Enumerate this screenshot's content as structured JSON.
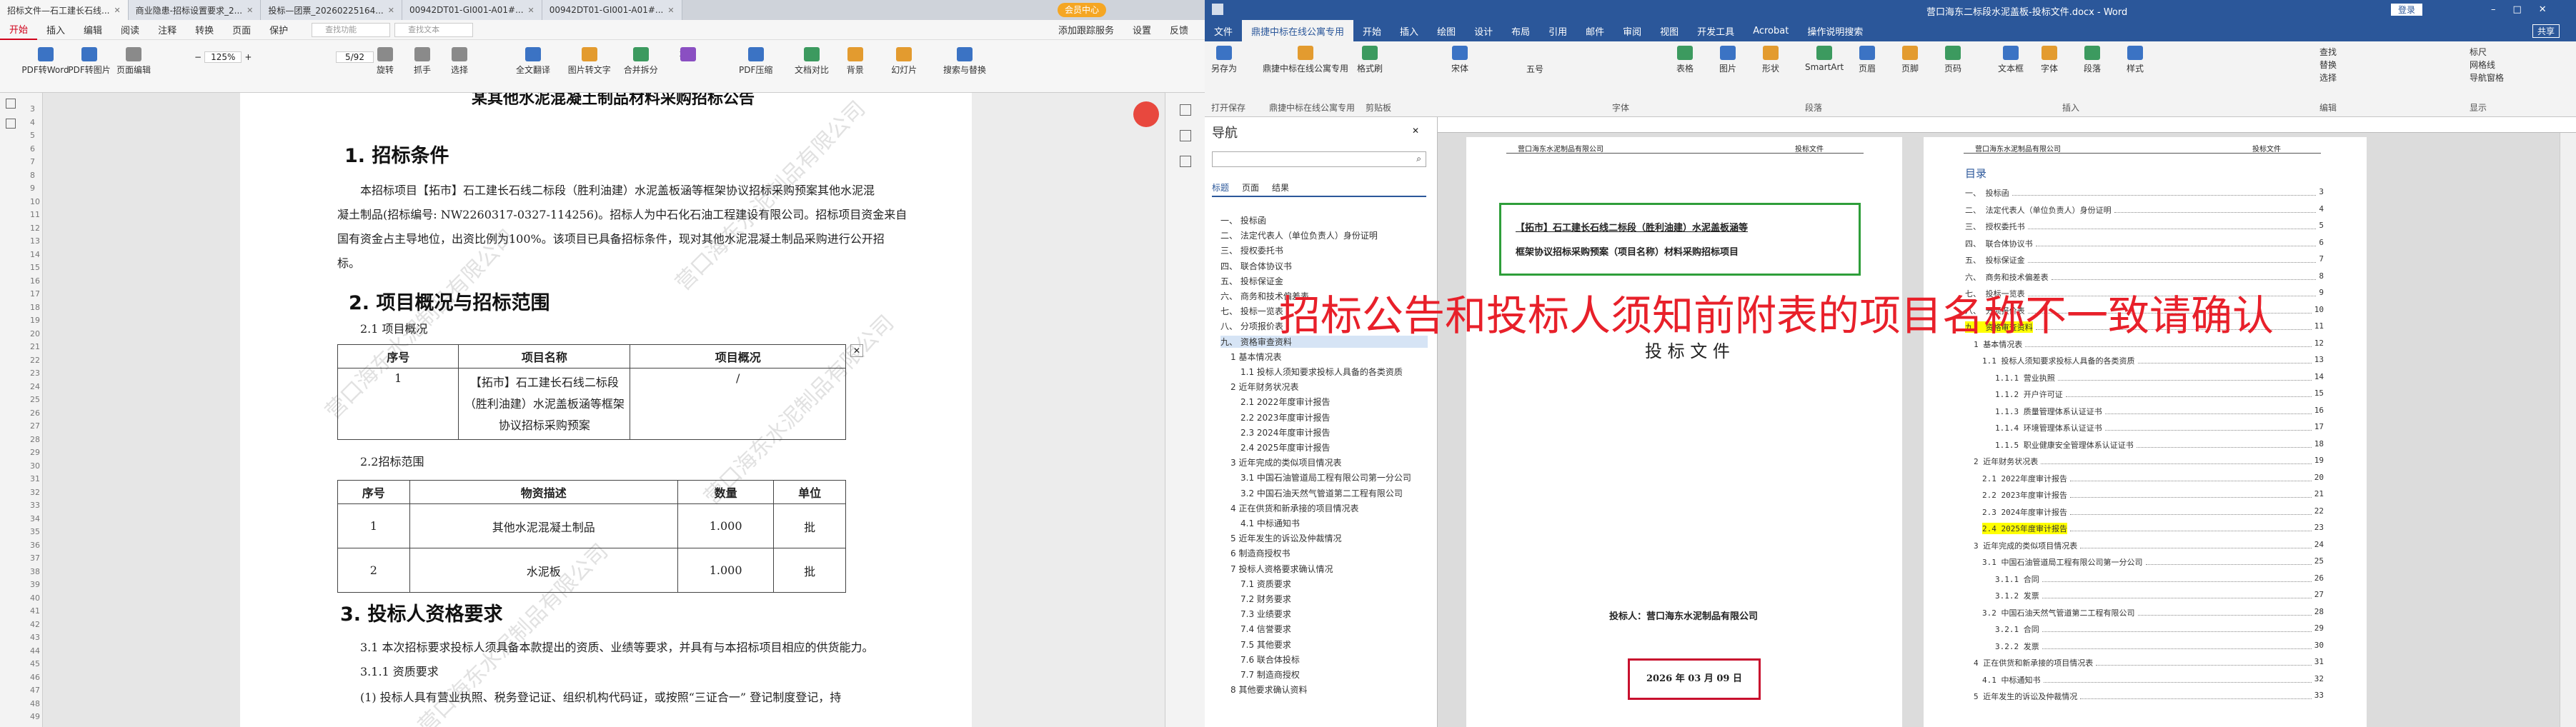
{
  "left": {
    "tabs": [
      "招标文件—石工建长石线...",
      "商业隐患-招标设置要求_2...",
      "投标—团票_20260225164...",
      "00942DT01-GI001-A01#...",
      "00942DT01-GI001-A01#..."
    ],
    "account": "会员中心",
    "menus": [
      "开始",
      "插入",
      "编辑",
      "阅读",
      "注释",
      "转换",
      "页面",
      "保护"
    ],
    "menus_right": [
      "添加跟踪服务",
      "设置",
      "反馈"
    ],
    "search_tool": "查找功能",
    "search_text": "查找文本",
    "toolbar": [
      "PDF转Word",
      "PDF转图片",
      "页面编辑",
      "旋转",
      "抓手",
      "选择",
      "全文翻译",
      "图片转文字",
      "合并拆分",
      "水印",
      "PDF压缩",
      "文档对比",
      "背景",
      "幻灯片",
      "搜索与替换"
    ],
    "zoom": "125%",
    "page": "5/92",
    "sidebar_nums": [
      "3",
      "4",
      "5",
      "6",
      "7",
      "8",
      "9",
      "10",
      "11",
      "12",
      "13",
      "14",
      "15",
      "16",
      "17",
      "18",
      "19",
      "20",
      "21",
      "22",
      "23",
      "24",
      "25",
      "26",
      "27",
      "28",
      "29",
      "30",
      "31",
      "32",
      "33",
      "34",
      "35",
      "36",
      "37",
      "38",
      "39",
      "40",
      "41",
      "42",
      "43",
      "44",
      "45",
      "46",
      "47",
      "48",
      "49"
    ],
    "doc": {
      "top_title": "某其他水泥混凝土制品材料采购招标公告",
      "h1": "1. 招标条件",
      "para1": [
        "本招标项目【拓市】石工建长石线二标段（胜利油建）水泥盖板涵等框架协议招标采购预案其他水泥混",
        "凝土制品(招标编号: NW2260317-0327-114256)。招标人为中石化石油工程建设有限公司。招标项目资金来自",
        "国有资金占主导地位，出资比例为100%。该项目已具备招标条件，现对其他水泥混凝土制品采购进行公开招",
        "标。"
      ],
      "h2": "2. 项目概况与招标范围",
      "sub21": "2.1 项目概况",
      "t1_head": [
        "序号",
        "项目名称",
        "项目概况"
      ],
      "t1_row": [
        "1",
        "【拓市】石工建长石线二标段（胜利油建）水泥盖板涵等框架协议招标采购预案",
        "/"
      ],
      "sub22": "2.2招标范围",
      "t2_head": [
        "序号",
        "物资描述",
        "数量",
        "单位"
      ],
      "t2_rows": [
        [
          "1",
          "其他水泥混凝土制品",
          "1.000",
          "批"
        ],
        [
          "2",
          "水泥板",
          "1.000",
          "批"
        ]
      ],
      "h3": "3. 投标人资格要求",
      "para3": "3.1 本次招标要求投标人须具备本款提出的资质、业绩等要求，并具有与本招标项目相应的供货能力。",
      "sub311": "3.1.1 资质要求",
      "para4": "(1)     投标人具有营业执照、税务登记证、组织机构代码证，或按照“三证合一” 登记制度登记，持",
      "watermark": "营口海东水泥制品有限公司"
    }
  },
  "right": {
    "title": "营口海东二标段水泥盖板-投标文件.docx - Word",
    "user": "登录",
    "share": "共享",
    "tabs": [
      "文件",
      "鼎捷中标在线公寓专用",
      "开始",
      "插入",
      "绘图",
      "设计",
      "布局",
      "引用",
      "邮件",
      "审阅",
      "视图",
      "开发工具",
      "Acrobat",
      "操作说明搜索"
    ],
    "ribbon": [
      "另存为",
      "鼎捷中标在线公寓专用",
      "格式刷",
      "宋体",
      "五号",
      "表格",
      "图片",
      "形状",
      "SmartArt",
      "页眉",
      "页脚",
      "页码",
      "文本框",
      "字体",
      "段落",
      "样式",
      "查找",
      "替换",
      "选择",
      "标尺",
      "网格线",
      "导航窗格"
    ],
    "ribbon_labels": [
      "打开保存",
      "鼎捷中标在线公寓专用",
      "剪贴板",
      "字体",
      "段落",
      "插入",
      "编辑",
      "显示"
    ],
    "nav_title": "导航",
    "nav_tabs": [
      "标题",
      "页面",
      "结果"
    ],
    "nav_items": [
      "一、 投标函",
      "二、 法定代表人（单位负责人）身份证明",
      "三、 授权委托书",
      "四、 联合体协议书",
      "五、 投标保证金",
      "六、 商务和技术偏差表",
      "七、 投标一览表",
      "八、 分项报价表",
      "九、 资格审查资料",
      "1 基本情况表",
      "1.1 投标人须知要求投标人具备的各类资质",
      "2 近年财务状况表",
      "2.1 2022年度审计报告",
      "2.2 2023年度审计报告",
      "2.3 2024年度审计报告",
      "2.4 2025年度审计报告",
      "3 近年完成的类似项目情况表",
      "3.1 中国石油管道局工程有限公司第一分公司",
      "3.2 中国石油天然气管道第二工程有限公司",
      "4 正在供货和新承接的项目情况表",
      "4.1 中标通知书",
      "5 近年发生的诉讼及仲裁情况",
      "6 制造商授权书",
      "7 投标人资格要求确认情况",
      "7.1 资质要求",
      "7.2 财务要求",
      "7.3 业绩要求",
      "7.4 信誉要求",
      "7.5 其他要求",
      "7.6 联合体投标",
      "7.7 制造商授权",
      "8 其他要求确认资料"
    ],
    "cover": {
      "header_left": "营口海东水泥制品有限公司",
      "header_right": "投标文件",
      "box_text": [
        "【拓市】石工建长石线二标段（胜利油建）水泥盖板涵等",
        "框架协议招标采购预案（项目名称）材料采购招标项目"
      ],
      "doc_type": "投 标 文 件",
      "bidder": "投标人：营口海东水泥制品有限公司",
      "date": "2026 年 03 月 09 日"
    },
    "toc": {
      "header_left": "营口海东水泥制品有限公司",
      "header_right": "投标文件",
      "title": "目录",
      "items": [
        "一、 投标函",
        "二、 法定代表人（单位负责人）身份证明",
        "三、 授权委托书",
        "四、 联合体协议书",
        "五、 投标保证金",
        "六、 商务和技术偏差表",
        "七、 投标一览表",
        "八、 分项报价表",
        "九、 资格审查资料",
        "1 基本情况表",
        "1.1 投标人须知要求投标人具备的各类资质",
        "1.1.1 营业执照",
        "1.1.2 开户许可证",
        "1.1.3 质量管理体系认证证书",
        "1.1.4 环境管理体系认证证书",
        "1.1.5 职业健康安全管理体系认证证书",
        "2 近年财务状况表",
        "2.1 2022年度审计报告",
        "2.2 2023年度审计报告",
        "2.3 2024年度审计报告",
        "2.4 2025年度审计报告",
        "3 近年完成的类似项目情况表",
        "3.1 中国石油管道局工程有限公司第一分公司",
        "3.1.1 合同",
        "3.1.2 发票",
        "3.2 中国石油天然气管道第二工程有限公司",
        "3.2.1 合同",
        "3.2.2 发票",
        "4 正在供货和新承接的项目情况表",
        "4.1 中标通知书",
        "5 近年发生的诉讼及仲裁情况"
      ],
      "pages": [
        "3",
        "4",
        "5",
        "6",
        "7",
        "8",
        "9",
        "10",
        "11",
        "12",
        "13",
        "14",
        "15",
        "16",
        "17",
        "18",
        "19",
        "20",
        "21",
        "22",
        "23",
        "24",
        "25",
        "26",
        "27",
        "28",
        "29",
        "30",
        "31",
        "32",
        "33"
      ]
    }
  },
  "overlay_text": "招标公告和投标人须知前附表的项目名称不一致请确认",
  "colors": {
    "accent_red": "#d0021b",
    "word_blue": "#2b579a",
    "box_green": "#2e9e3a",
    "box_red": "#c8102e",
    "highlight": "#ffff00"
  }
}
